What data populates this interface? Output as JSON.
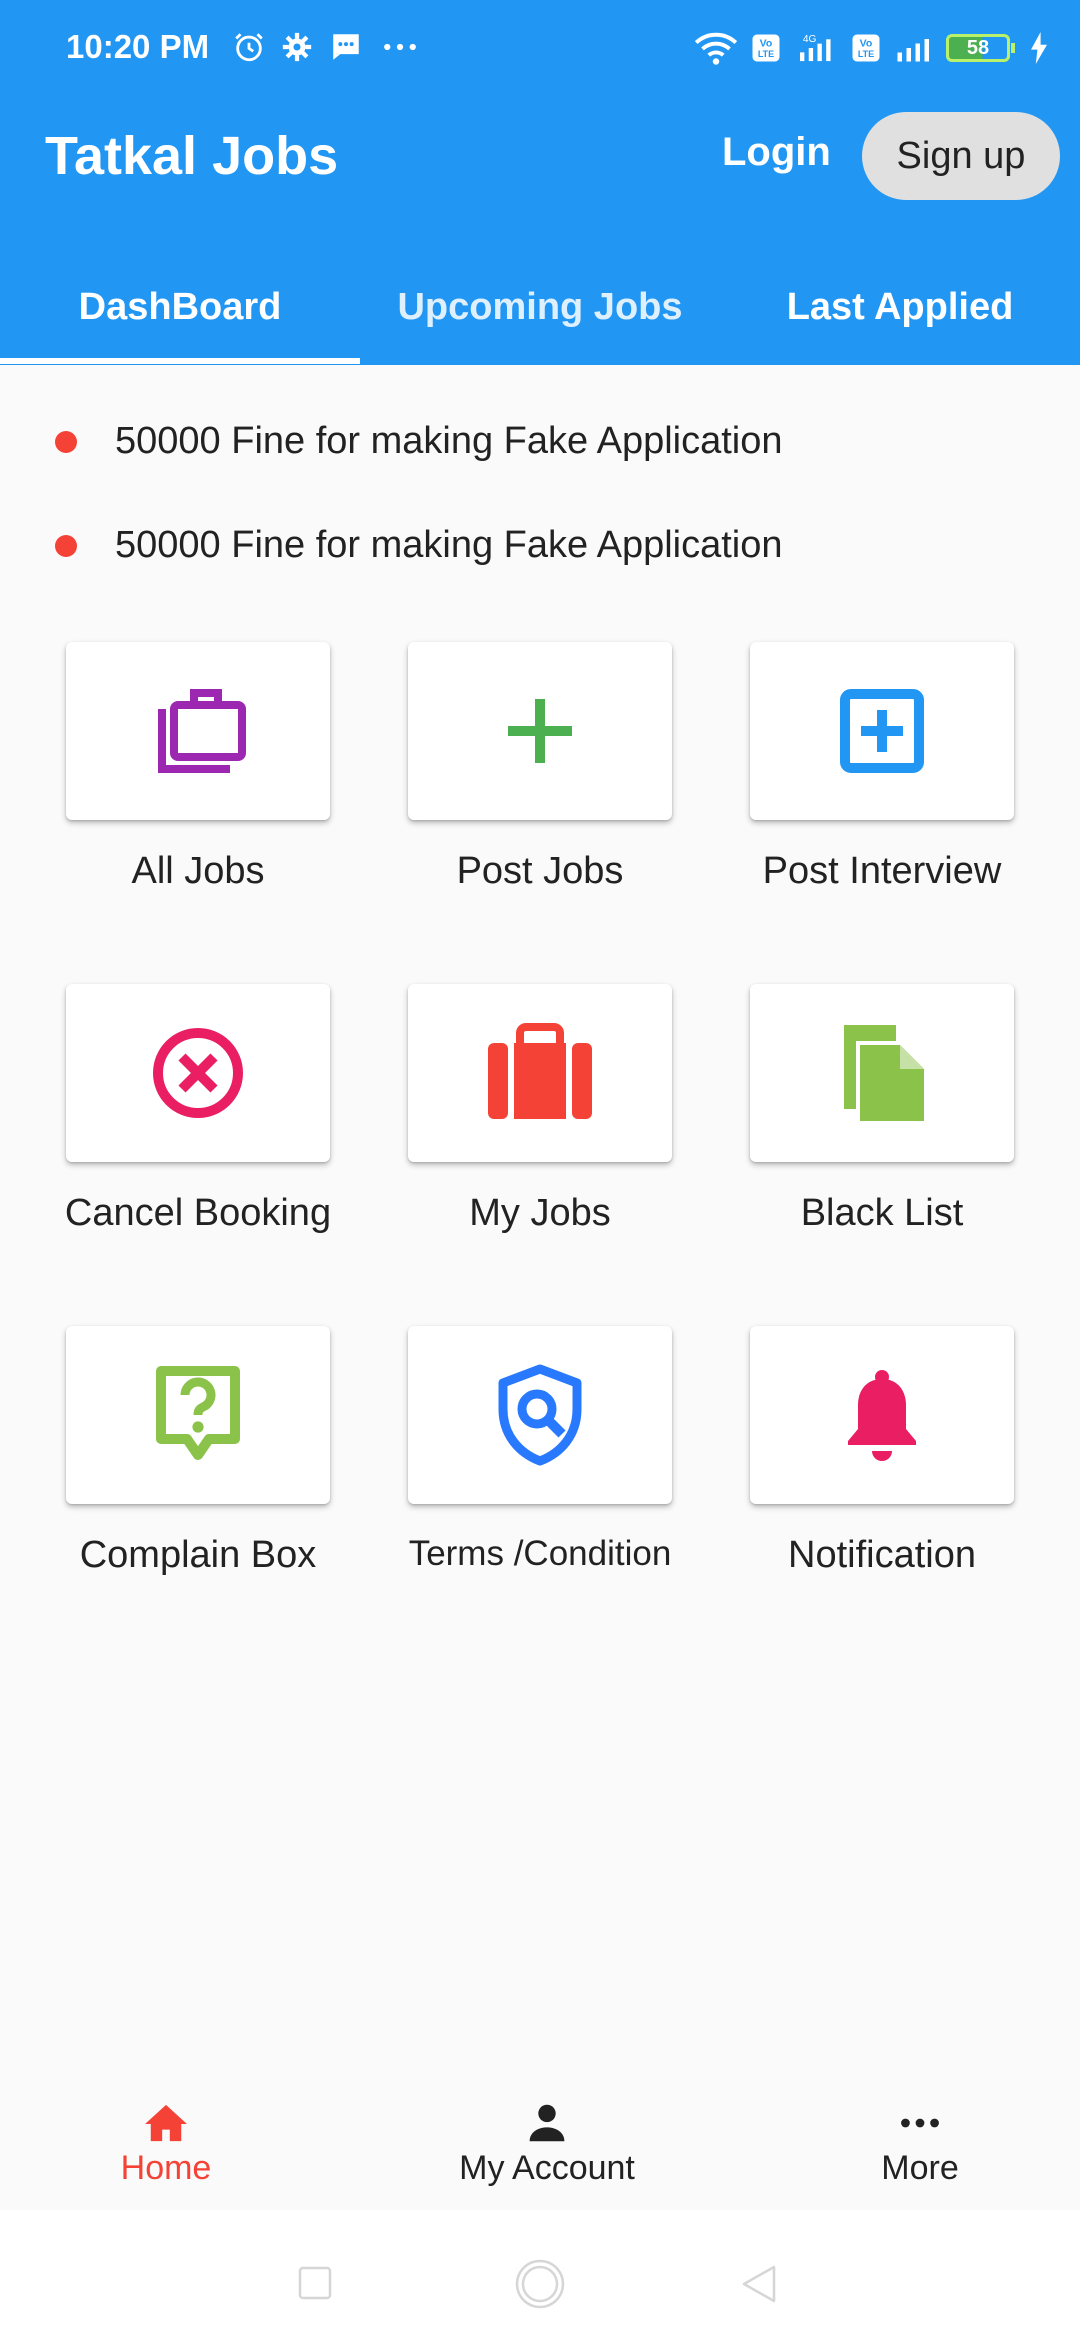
{
  "status_bar": {
    "time": "10:20 PM",
    "battery": "58",
    "icons": [
      "alarm-icon",
      "settings-icon",
      "message-icon",
      "more-dots-icon",
      "wifi-icon",
      "volte-icon",
      "signal-icon",
      "charging-icon"
    ],
    "network_label": "4G"
  },
  "app_bar": {
    "title": "Tatkal Jobs",
    "login_label": "Login",
    "signup_label": "Sign up",
    "accent_color": "#2196f3"
  },
  "tabs": [
    {
      "label": "DashBoard",
      "selected": true
    },
    {
      "label": "Upcoming Jobs",
      "selected": false
    },
    {
      "label": "Last Applied",
      "selected": false
    }
  ],
  "notices": [
    "50000 Fine for making Fake Application",
    "50000 Fine for making Fake Application"
  ],
  "tiles": [
    {
      "label": "All Jobs",
      "icon": "briefcase-outline-icon",
      "color": "#9c27b0"
    },
    {
      "label": "Post Jobs",
      "icon": "plus-icon",
      "color": "#4caf50"
    },
    {
      "label": "Post Interview",
      "icon": "add-box-icon",
      "color": "#2196f3"
    },
    {
      "label": "Cancel Booking",
      "icon": "cancel-circle-icon",
      "color": "#e91e63"
    },
    {
      "label": "My Jobs",
      "icon": "luggage-icon",
      "color": "#f44336"
    },
    {
      "label": "Black List",
      "icon": "copy-file-icon",
      "color": "#8bc34a"
    },
    {
      "label": "Complain Box",
      "icon": "question-box-icon",
      "color": "#8bc34a"
    },
    {
      "label": "Terms /Condition",
      "icon": "shield-search-icon",
      "color": "#2979ff"
    },
    {
      "label": "Notification",
      "icon": "bell-icon",
      "color": "#e91e63"
    }
  ],
  "bottom_nav": [
    {
      "label": "Home",
      "icon": "home-icon",
      "active": true
    },
    {
      "label": "My Account",
      "icon": "person-icon",
      "active": false
    },
    {
      "label": "More",
      "icon": "more-horiz-icon",
      "active": false
    }
  ]
}
